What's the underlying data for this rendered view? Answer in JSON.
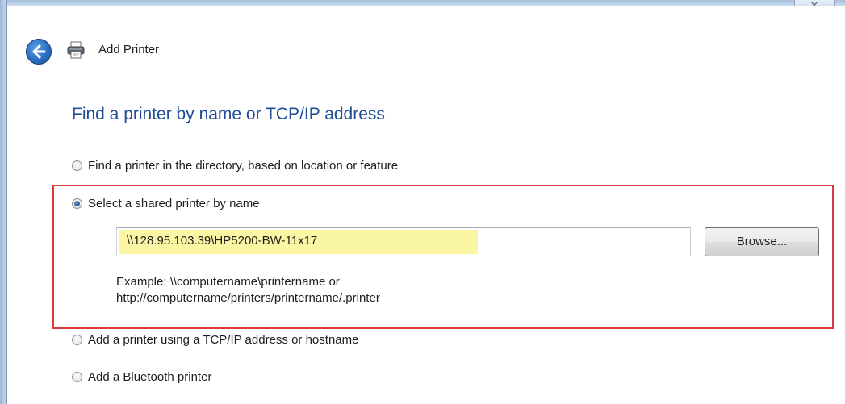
{
  "window": {
    "title": "Add Printer",
    "close_label": "✕"
  },
  "page": {
    "heading": "Find a printer by name or TCP/IP address"
  },
  "options": [
    {
      "label": "Find a printer in the directory, based on location or feature",
      "checked": false
    },
    {
      "label": "Select a shared printer by name",
      "checked": true
    },
    {
      "label": "Add a printer using a TCP/IP address or hostname",
      "checked": false
    },
    {
      "label": "Add a Bluetooth printer",
      "checked": false
    }
  ],
  "shared_printer": {
    "value": "\\\\128.95.103.39\\HP5200-BW-11x17",
    "browse_label": "Browse...",
    "example_line1": "Example: \\\\computername\\printername or",
    "example_line2": "http://computername/printers/printername/.printer"
  },
  "colors": {
    "heading": "#1f4e97",
    "highlight_border": "#d63a3a",
    "input_highlight": "#fbf6a3"
  },
  "icons": {
    "back": "back-arrow-icon",
    "printer": "printer-icon",
    "close": "close-icon"
  }
}
